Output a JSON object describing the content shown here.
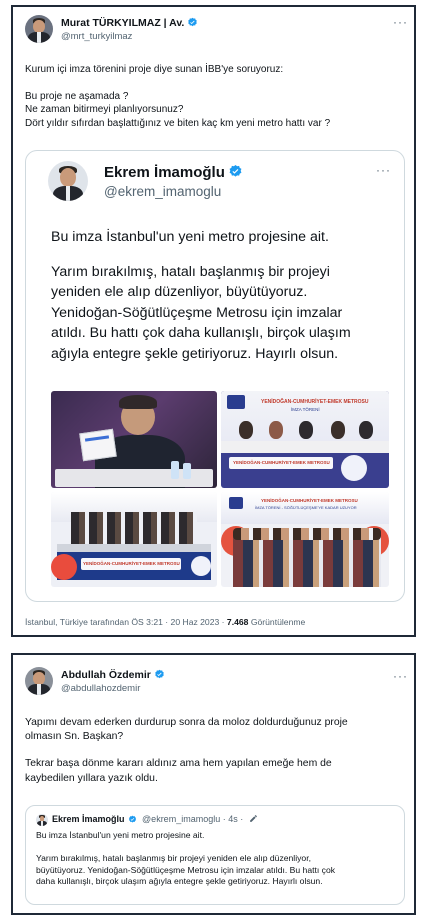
{
  "colors": {
    "verified": "#1d9bf0",
    "text": "#0f1419",
    "muted": "#536471",
    "border": "#cfd9de",
    "ibb_banner": "#2a3d8f"
  },
  "tweet1": {
    "author": "Murat TÜRKYILMAZ | Av.",
    "handle": "@mrt_turkyilmaz",
    "more": "···",
    "lines": [
      "Kurum içi imza törenini proje diye sunan İBB'ye soruyoruz:",
      "Bu proje ne aşamada ?",
      "Ne zaman bitirmeyi planlıyorsunuz?",
      "Dört yıldır sıfırdan başlattığınız ve biten kaç km yeni metro hattı var ?"
    ],
    "quote": {
      "author": "Ekrem İmamoğlu",
      "handle": "@ekrem_imamoglu",
      "more": "···",
      "lines": [
        "Bu imza İstanbul'un yeni metro projesine ait.",
        "Yarım bırakılmış, hatalı başlanmış bir projeyi",
        "yeniden ele alıp düzenliyor, büyütüyoruz.",
        "Yenidoğan-Söğütlüçeşme Metrosu için imzalar",
        "atıldı. Bu hattı çok daha kullanışlı, birçok ulaşım",
        "ağıyla entegre şekle getiriyoruz. Hayırlı olsun."
      ],
      "photos": {
        "banner1": "YENİDOĞAN-CUMHURİYET-EMEK METROSU",
        "banner1_sub": "İMZA TÖRENİ",
        "banner2": "YENİDOĞAN-CUMHURİYET-EMEK METROSU",
        "banner3": "YENİDOĞAN-CUMHURİYET-EMEK METROSU",
        "banner4": "YENİDOĞAN-CUMHURİYET-EMEK METROSU",
        "banner4_sub": "İMZA TÖRENİ - SÖĞÜTLÜÇEŞME'YE KADAR UZUYOR"
      }
    },
    "footer_prefix": "İstanbul, Türkiye tarafından ÖS 3:21 · 20 Haz 2023 · ",
    "views_count": "7.468",
    "views_label": " Görüntülenme"
  },
  "tweet2": {
    "author": "Abdullah Özdemir",
    "handle": "@abdullahozdemir",
    "more": "···",
    "lines": [
      "Yapımı devam ederken durdurup sonra da moloz doldurduğunuz proje",
      "olmasın Sn. Başkan?",
      "Tekrar başa dönme kararı aldınız ama hem yapılan emeğe hem de",
      "kaybedilen yıllara yazık oldu."
    ],
    "quote": {
      "author": "Ekrem İmamoğlu",
      "handle": "@ekrem_imamoglu · 4s ·",
      "lines": [
        "Bu imza İstanbul'un yeni metro projesine ait.",
        "Yarım bırakılmış, hatalı başlanmış bir projeyi yeniden ele alıp düzenliyor,",
        "büyütüyoruz. Yenidoğan-Söğütlüçeşme Metrosu için imzalar atıldı. Bu hattı çok",
        "daha kullanışlı, birçok ulaşım ağıyla entegre şekle getiriyoruz. Hayırlı olsun."
      ]
    }
  }
}
